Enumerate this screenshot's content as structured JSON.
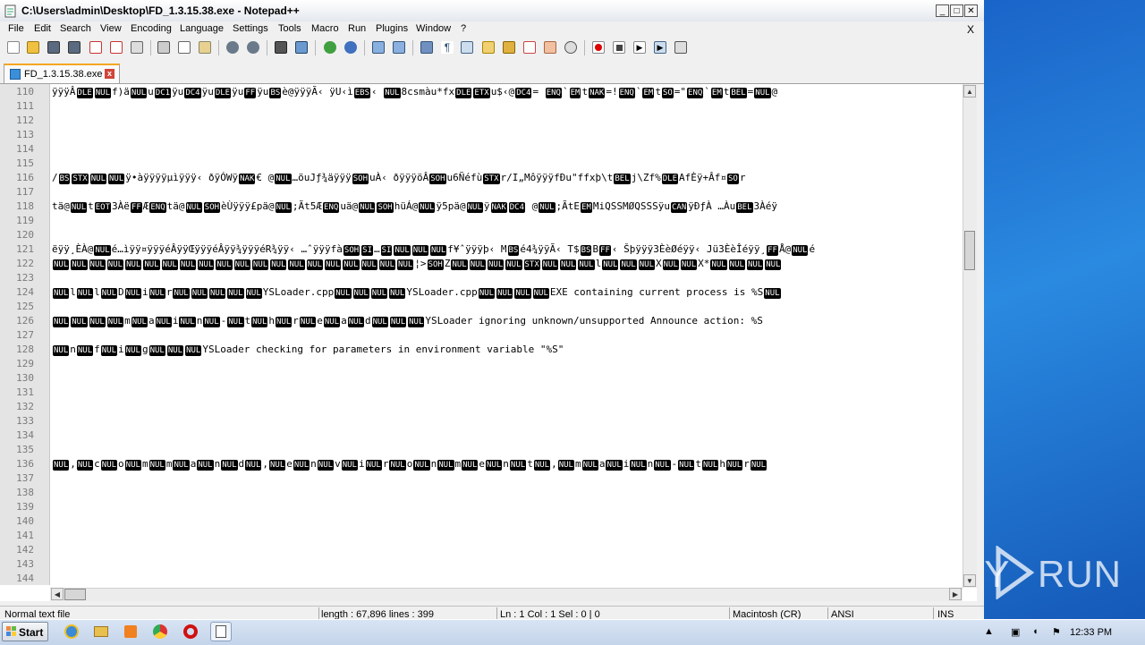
{
  "window": {
    "title": "C:\\Users\\admin\\Desktop\\FD_1.3.15.38.exe - Notepad++",
    "min_label": "0",
    "max_label": "1",
    "close_label": "r"
  },
  "menu": [
    "File",
    "Edit",
    "Search",
    "View",
    "Encoding",
    "Language",
    "Settings",
    "Tools",
    "Macro",
    "Run",
    "Plugins",
    "Window",
    "?"
  ],
  "mdi_close": "X",
  "tab": {
    "label": "FD_1.3.15.38.exe",
    "close": "x"
  },
  "lines": [
    {
      "n": "110",
      "t": "ÿÿÿÂ[DLE][NUL]f)ä[NUL]u[DC1]ÿu[DC4]ÿu[DLE]ÿu[FF]ÿu[BS]è@ÿÿÿÃ‹ ÿU‹ì[EBS]‹ [NUL]8csmàu*fx[DLE][ETX]u$‹@[DC4]=  [ENQ]`[EM]t[NAK]=![ENQ]`[EM]t[SO]=\"[ENQ]`[EM]t[BEL]=[NUL]@"
    },
    {
      "n": "111",
      "t": ""
    },
    {
      "n": "112",
      "t": ""
    },
    {
      "n": "113",
      "t": ""
    },
    {
      "n": "114",
      "t": ""
    },
    {
      "n": "115",
      "t": ""
    },
    {
      "n": "116",
      "t": "/[BS][STX][NUL][NUL]ÿ•àÿÿÿÿµìÿÿÿ‹ ðÿÓWÿ[NAK]€ @[NUL]…öuJƒ¾äÿÿÿ[SOH]uÀ‹ ðÿÿÿöÂ[SOH]u6Ñéfù[STX]r/I„MôÿÿÿfÐu\"ffxþ\\t[BEL]j\\Zf%[DLE]AfÈÿ+Âf¤[SO]r"
    },
    {
      "n": "117",
      "t": ""
    },
    {
      "n": "118",
      "t": "tä@[NUL]t[EOT]3Àë[FF]Æ[ENQ]tä@[NUL][SOH]èÙÿÿÿ£pä@[NUL];Ãt5Æ[ENQ]uä@[NUL][SOH]hüÁ@[NUL]ÿ5pä@[NUL]ÿ[NAK][DC4] @[NUL];ÃtE[EM]MiQSSMØQSSSÿu[CAN]ÿÐƒÀ …Àu[BEL]3Àéÿ"
    },
    {
      "n": "119",
      "t": ""
    },
    {
      "n": "120",
      "t": ""
    },
    {
      "n": "121",
      "t": " ëÿÿ¸ÈÀ@[NUL]é…ìÿÿ¤ÿÿÿéÂÿÿŒÿÿÿéÂÿÿ¾ÿÿÿéR¾ÿÿ‹ …ˆÿÿÿfà[SOH][SI]…[SI][NUL][NUL][NUL]f¥ˆÿÿÿþ‹ M[BS]é4¾ÿÿÃ‹ T$[BS]B[FF]‹ Šþÿÿÿ3ÈèØéÿÿ‹ Jü3ÈèÎéÿÿ¸[FF]Å@[NUL]é"
    },
    {
      "n": "122",
      "t": "[NUL][NUL][NUL][NUL][NUL][NUL][NUL][NUL][NUL][NUL][NUL][NUL][NUL][NUL][NUL][NUL][NUL][NUL][NUL][NUL]¦>[SOH]Z[NUL][NUL][NUL][NUL][STX][NUL][NUL][NUL]l[NUL][NUL][NUL]X[NUL][NUL]X*[NUL][NUL][NUL][NUL]"
    },
    {
      "n": "123",
      "t": ""
    },
    {
      "n": "124",
      "t": "[NUL]l[NUL]l[NUL]D[NUL]i[NUL]r[NUL][NUL][NUL][NUL][NUL]YSLoader.cpp[NUL][NUL][NUL][NUL]YSLoader.cpp[NUL][NUL][NUL][NUL]EXE containing current process is %S[NUL]"
    },
    {
      "n": "125",
      "t": ""
    },
    {
      "n": "126",
      "t": "[NUL][NUL][NUL][NUL]m[NUL]a[NUL]i[NUL]n[NUL]-[NUL]t[NUL]h[NUL]r[NUL]e[NUL]a[NUL]d[NUL][NUL][NUL]YSLoader ignoring unknown/unsupported Announce action: %S"
    },
    {
      "n": "127",
      "t": ""
    },
    {
      "n": "128",
      "t": "[NUL]n[NUL]f[NUL]i[NUL]g[NUL][NUL][NUL]YSLoader checking for parameters in environment variable \"%S\""
    },
    {
      "n": "129",
      "t": ""
    },
    {
      "n": "130",
      "t": ""
    },
    {
      "n": "131",
      "t": ""
    },
    {
      "n": "132",
      "t": ""
    },
    {
      "n": "133",
      "t": ""
    },
    {
      "n": "134",
      "t": ""
    },
    {
      "n": "135",
      "t": ""
    },
    {
      "n": "136",
      "t": "[NUL],[NUL]c[NUL]o[NUL]m[NUL]m[NUL]a[NUL]n[NUL]d[NUL],[NUL]e[NUL]n[NUL]v[NUL]i[NUL]r[NUL]o[NUL]n[NUL]m[NUL]e[NUL]n[NUL]t[NUL],[NUL]m[NUL]a[NUL]i[NUL]n[NUL]-[NUL]t[NUL]h[NUL]r[NUL]"
    },
    {
      "n": "137",
      "t": ""
    },
    {
      "n": "138",
      "t": ""
    },
    {
      "n": "139",
      "t": ""
    },
    {
      "n": "140",
      "t": ""
    },
    {
      "n": "141",
      "t": ""
    },
    {
      "n": "142",
      "t": ""
    },
    {
      "n": "143",
      "t": ""
    },
    {
      "n": "144",
      "t": ""
    }
  ],
  "status": {
    "type": "Normal text file",
    "length": "length : 67,896    lines : 399",
    "pos": "Ln : 1    Col : 1    Sel : 0 | 0",
    "eol": "Macintosh (CR)",
    "enc": "ANSI",
    "ins": "INS"
  },
  "taskbar": {
    "start": "Start",
    "clock": "12:33 PM"
  },
  "watermark": {
    "a": "ANY",
    "b": "RUN"
  },
  "icons": [
    "new-file-icon",
    "open-icon",
    "save-icon",
    "save-all-icon",
    "close-icon",
    "close-all-icon",
    "print-icon",
    "cut-icon",
    "copy-icon",
    "paste-icon",
    "undo-icon",
    "redo-icon",
    "find-icon",
    "replace-icon",
    "zoom-in-icon",
    "zoom-out-icon",
    "sync-v-icon",
    "sync-h-icon",
    "word-wrap-icon",
    "all-chars-icon",
    "indent-guide-icon",
    "udl-icon",
    "doc-map-icon",
    "function-list-icon",
    "folder-workspace-icon",
    "monitor-icon",
    "record-icon",
    "stop-icon",
    "play-icon",
    "play-multi-icon",
    "save-macro-icon"
  ]
}
